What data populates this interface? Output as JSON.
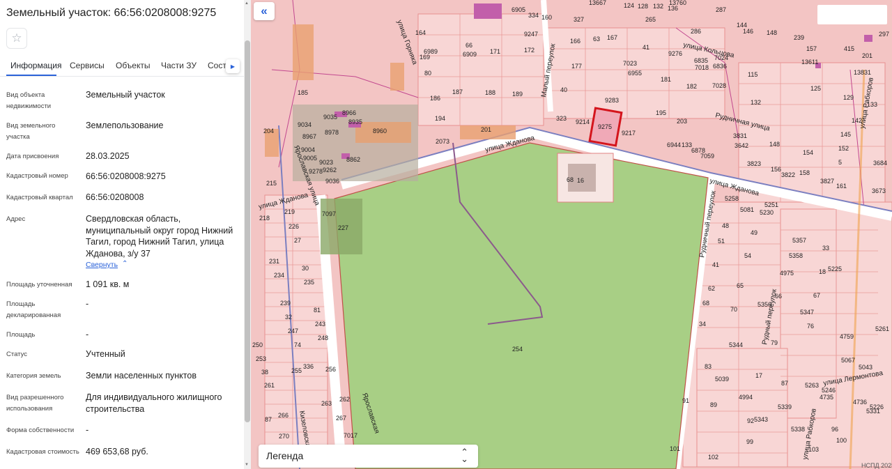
{
  "panel": {
    "title": "Земельный участок: 66:56:0208008:9275",
    "favorite_icon": "star-icon",
    "tabs": [
      "Информация",
      "Сервисы",
      "Объекты",
      "Части ЗУ",
      "Соста"
    ],
    "properties": [
      {
        "label": "Вид объекта недвижимости",
        "value": "Земельный участок"
      },
      {
        "label": "Вид земельного участка",
        "value": "Землепользование"
      },
      {
        "label": "Дата присвоения",
        "value": "28.03.2025"
      },
      {
        "label": "Кадастровый номер",
        "value": "66:56:0208008:9275"
      },
      {
        "label": "Кадастровый квартал",
        "value": "66:56:0208008"
      },
      {
        "label": "Адрес",
        "value": "Свердловская область, муниципальный округ город Нижний Тагил, город Нижний Тагил, улица Жданова, з/у 37"
      },
      {
        "label": "Площадь уточненная",
        "value": "1 091 кв. м"
      },
      {
        "label": "Площадь декларированная",
        "value": "-"
      },
      {
        "label": "Площадь",
        "value": "-"
      },
      {
        "label": "Статус",
        "value": "Учтенный"
      },
      {
        "label": "Категория земель",
        "value": "Земли населенных пунктов"
      },
      {
        "label": "Вид разрешенного использования",
        "value": "Для индивидуального жилищного строительства"
      },
      {
        "label": "Форма собственности",
        "value": "-"
      },
      {
        "label": "Кадастровая стоимость",
        "value": "469 653,68 руб."
      }
    ],
    "collapse_link": "Свернуть"
  },
  "map": {
    "collapse_icon": "double-chevron-left-icon",
    "legend_label": "Легенда",
    "copyright": "НСПД 2025",
    "selected_parcel": "9275",
    "streets": [
      "улица Жданова",
      "улица Жданова",
      "улица Кольцова",
      "Рудничная улица",
      "Рудничный переулок",
      "Малый переулок",
      "Ярославская улица",
      "Ярославская",
      "улица Лермонтова",
      "улица Рабкоров",
      "улица Рабкоров",
      "Рудный переулок",
      "Кизеловская",
      "улица Горняка",
      "улица Жданова"
    ],
    "parcels": [
      "254",
      "68",
      "16",
      "9214",
      "323",
      "9283",
      "9217",
      "195",
      "203",
      "6944",
      "133",
      "6878",
      "7059",
      "40",
      "41",
      "9276",
      "7023",
      "6955",
      "181",
      "182",
      "7028",
      "6835",
      "6836",
      "7024",
      "7018",
      "177",
      "166",
      "63",
      "167",
      "327",
      "201",
      "2073",
      "194",
      "186",
      "187",
      "188",
      "189",
      "164",
      "6989",
      "169",
      "80",
      "66",
      "6909",
      "171",
      "172",
      "9247",
      "6905",
      "334",
      "160",
      "8960",
      "8966",
      "8935",
      "8978",
      "9035",
      "9034",
      "8967",
      "9004",
      "9005",
      "9023",
      "9262",
      "9278",
      "9036",
      "8862",
      "7097",
      "227",
      "185",
      "204",
      "215",
      "218",
      "219",
      "226",
      "231",
      "234",
      "235",
      "239",
      "243",
      "247",
      "248",
      "250",
      "253",
      "255",
      "256",
      "261",
      "262",
      "263",
      "266",
      "267",
      "270",
      "87",
      "7017",
      "30",
      "81",
      "74",
      "32",
      "27",
      "38",
      "336",
      "5258",
      "5081",
      "5251",
      "5230",
      "48",
      "49",
      "51",
      "54",
      "41",
      "62",
      "65",
      "68",
      "70",
      "34",
      "5357",
      "5358",
      "33",
      "4975",
      "5225",
      "18",
      "66",
      "67",
      "5356",
      "5347",
      "76",
      "79",
      "5344",
      "4759",
      "5067",
      "5043",
      "5261",
      "5263",
      "5039",
      "4994",
      "5339",
      "5343",
      "5338",
      "91",
      "89",
      "92",
      "99",
      "101",
      "102",
      "96",
      "100",
      "103",
      "4736",
      "4735",
      "5246",
      "5226",
      "5331",
      "87",
      "17",
      "83",
      "3831",
      "3642",
      "148",
      "3823",
      "156",
      "154",
      "3822",
      "158",
      "3827",
      "161",
      "152",
      "145",
      "142",
      "129",
      "133",
      "125",
      "115",
      "132",
      "3684",
      "3673",
      "5",
      "13611",
      "13831",
      "13667",
      "124",
      "128",
      "132",
      "136",
      "13760",
      "265",
      "286",
      "287",
      "297",
      "239",
      "157",
      "415",
      "201",
      "146",
      "144",
      "148"
    ]
  }
}
